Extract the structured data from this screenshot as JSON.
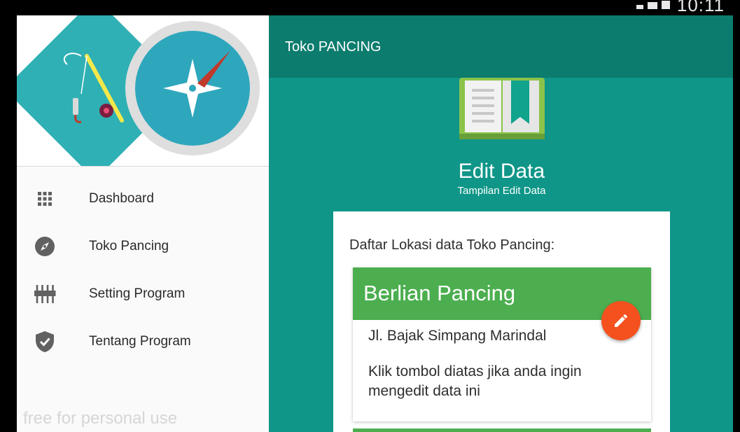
{
  "status_bar": {
    "time": "10:11"
  },
  "drawer": {
    "header_logo": "fishing-compass-logo",
    "items": [
      {
        "label": "Dashboard",
        "icon": "grid-icon"
      },
      {
        "label": "Toko Pancing",
        "icon": "compass-icon"
      },
      {
        "label": "Setting Program",
        "icon": "sliders-icon"
      },
      {
        "label": "Tentang Program",
        "icon": "shield-check-icon"
      }
    ],
    "watermark": "free for personal use"
  },
  "toolbar": {
    "title": "Toko PANCING"
  },
  "panel": {
    "icon": "book-icon",
    "title": "Edit Data",
    "subtitle": "Tampilan Edit Data",
    "list_title": "Daftar Lokasi data Toko Pancing:",
    "cards": [
      {
        "title": "Berlian Pancing",
        "address": "Jl. Bajak Simpang Marindal",
        "note": "Klik tombol diatas jika anda ingin mengedit data ini"
      }
    ],
    "fab_icon": "edit-icon"
  },
  "colors": {
    "primary": "#0f9688",
    "primary_dark": "#0b7c6e",
    "card_header": "#4cae4f",
    "fab": "#f4511e"
  }
}
